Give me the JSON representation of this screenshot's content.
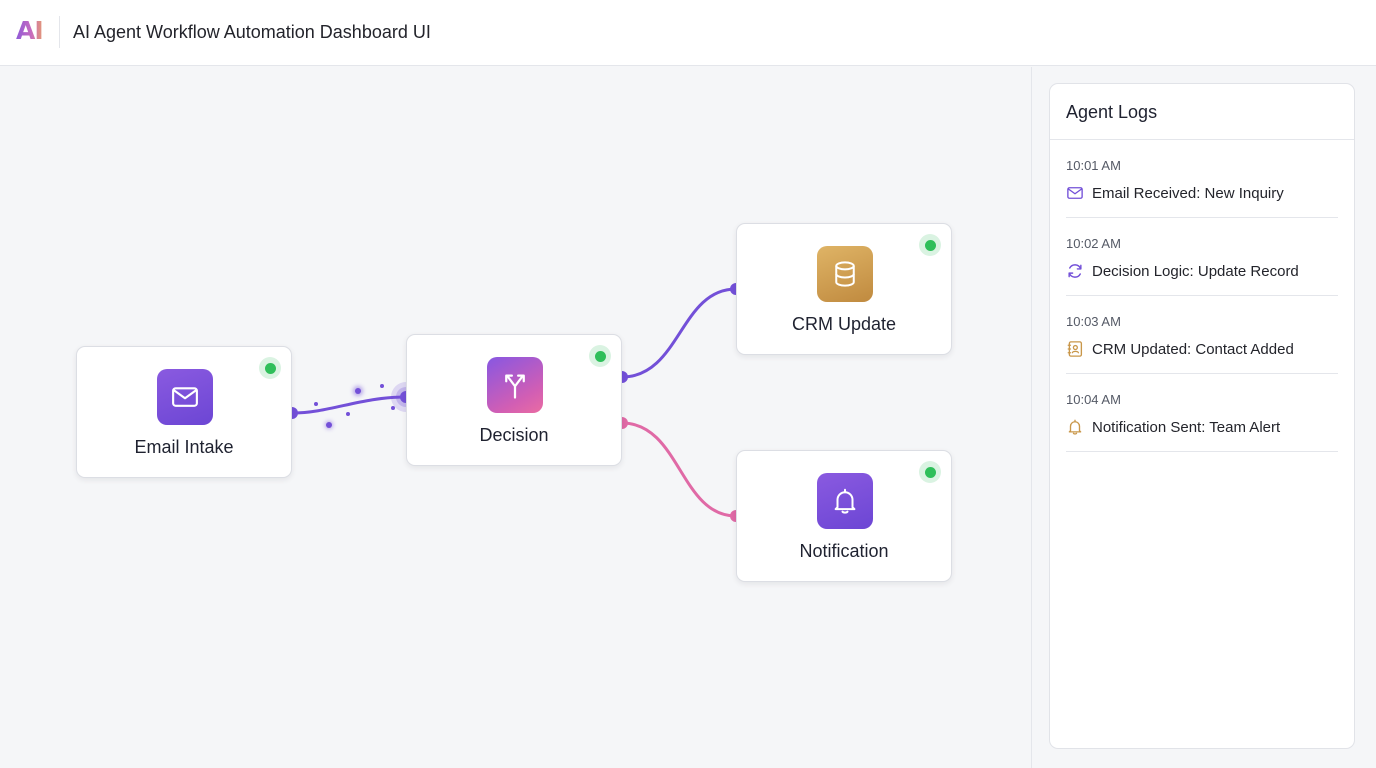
{
  "header": {
    "logo_text": "AI",
    "title": "AI Agent Workflow Automation Dashboard UI"
  },
  "colors": {
    "purple": "#7350d8",
    "pink": "#e06aa6",
    "gold": "#c9974a",
    "status_green": "#2fbf5a"
  },
  "workflow": {
    "nodes": [
      {
        "id": "email-intake",
        "label": "Email Intake",
        "icon": "mail-icon",
        "status": "active"
      },
      {
        "id": "decision",
        "label": "Decision",
        "icon": "branch-split-icon",
        "status": "active"
      },
      {
        "id": "crm-update",
        "label": "CRM Update",
        "icon": "database-icon",
        "status": "active"
      },
      {
        "id": "notification",
        "label": "Notification",
        "icon": "bell-icon",
        "status": "active"
      }
    ],
    "edges": [
      {
        "from": "email-intake",
        "to": "decision",
        "color": "#7350d8",
        "animated": true
      },
      {
        "from": "decision",
        "to": "crm-update",
        "color": "#7350d8"
      },
      {
        "from": "decision",
        "to": "notification",
        "color": "#e06aa6"
      }
    ]
  },
  "logs": {
    "title": "Agent Logs",
    "entries": [
      {
        "time": "10:01 AM",
        "icon": "mail-icon",
        "message": "Email Received: New Inquiry"
      },
      {
        "time": "10:02 AM",
        "icon": "refresh-icon",
        "message": "Decision Logic: Update Record"
      },
      {
        "time": "10:03 AM",
        "icon": "contact-book-icon",
        "message": "CRM Updated: Contact Added"
      },
      {
        "time": "10:04 AM",
        "icon": "bell-icon",
        "message": "Notification Sent: Team Alert"
      }
    ]
  }
}
